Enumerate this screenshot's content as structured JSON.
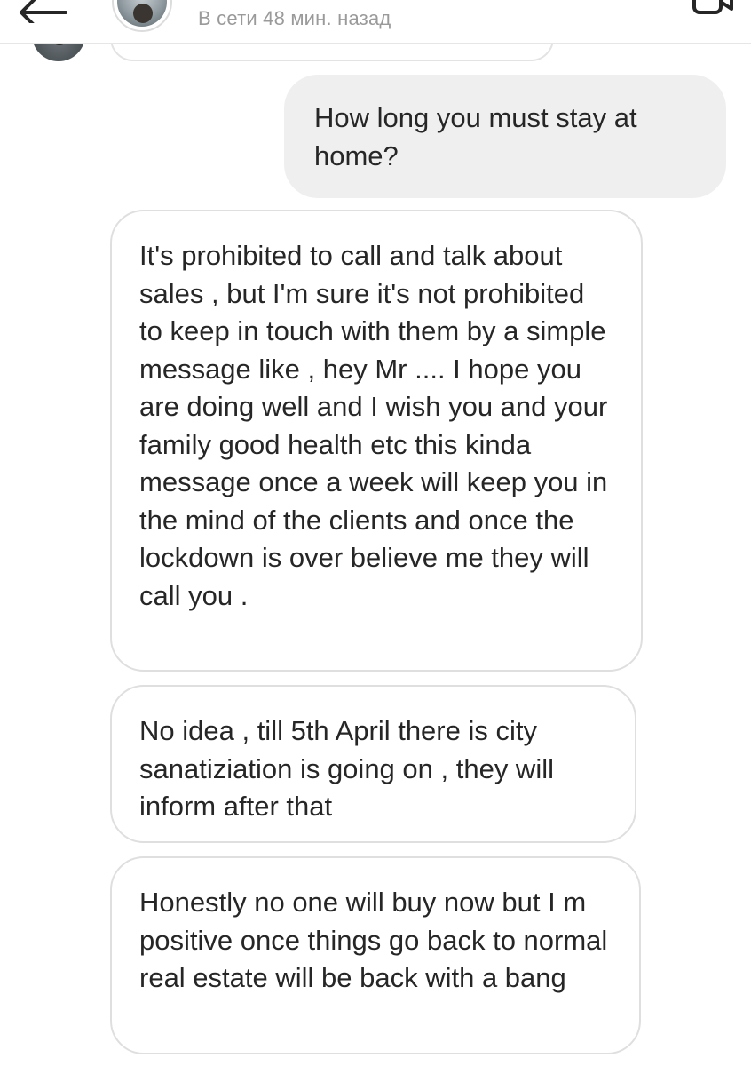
{
  "header": {
    "status": "В сети 48 мин. назад",
    "back_icon": "back-arrow-icon",
    "video_icon": "video-call-icon"
  },
  "messages": [
    {
      "direction": "sent",
      "text": "How long you must stay at home?"
    },
    {
      "direction": "received",
      "text": "It's prohibited to call and talk about sales , but I'm sure it's not prohibited to keep in touch with them by a simple message like , hey Mr .... I hope you are doing well and I wish you and your family good health etc this kinda message once a week will keep you in the mind of the clients and once the lockdown is over believe me they will call you ."
    },
    {
      "direction": "received",
      "text": "No idea , till 5th April there is city sanatiziation is going on , they will inform after that"
    },
    {
      "direction": "received",
      "text": "Honestly no one will buy now but I m positive once things go back to normal real estate will be back with a bang"
    }
  ],
  "colors": {
    "sent_bubble": "#efefef",
    "received_border": "#dfdfdf",
    "text": "#262626",
    "status_text": "#9a9a9a"
  }
}
